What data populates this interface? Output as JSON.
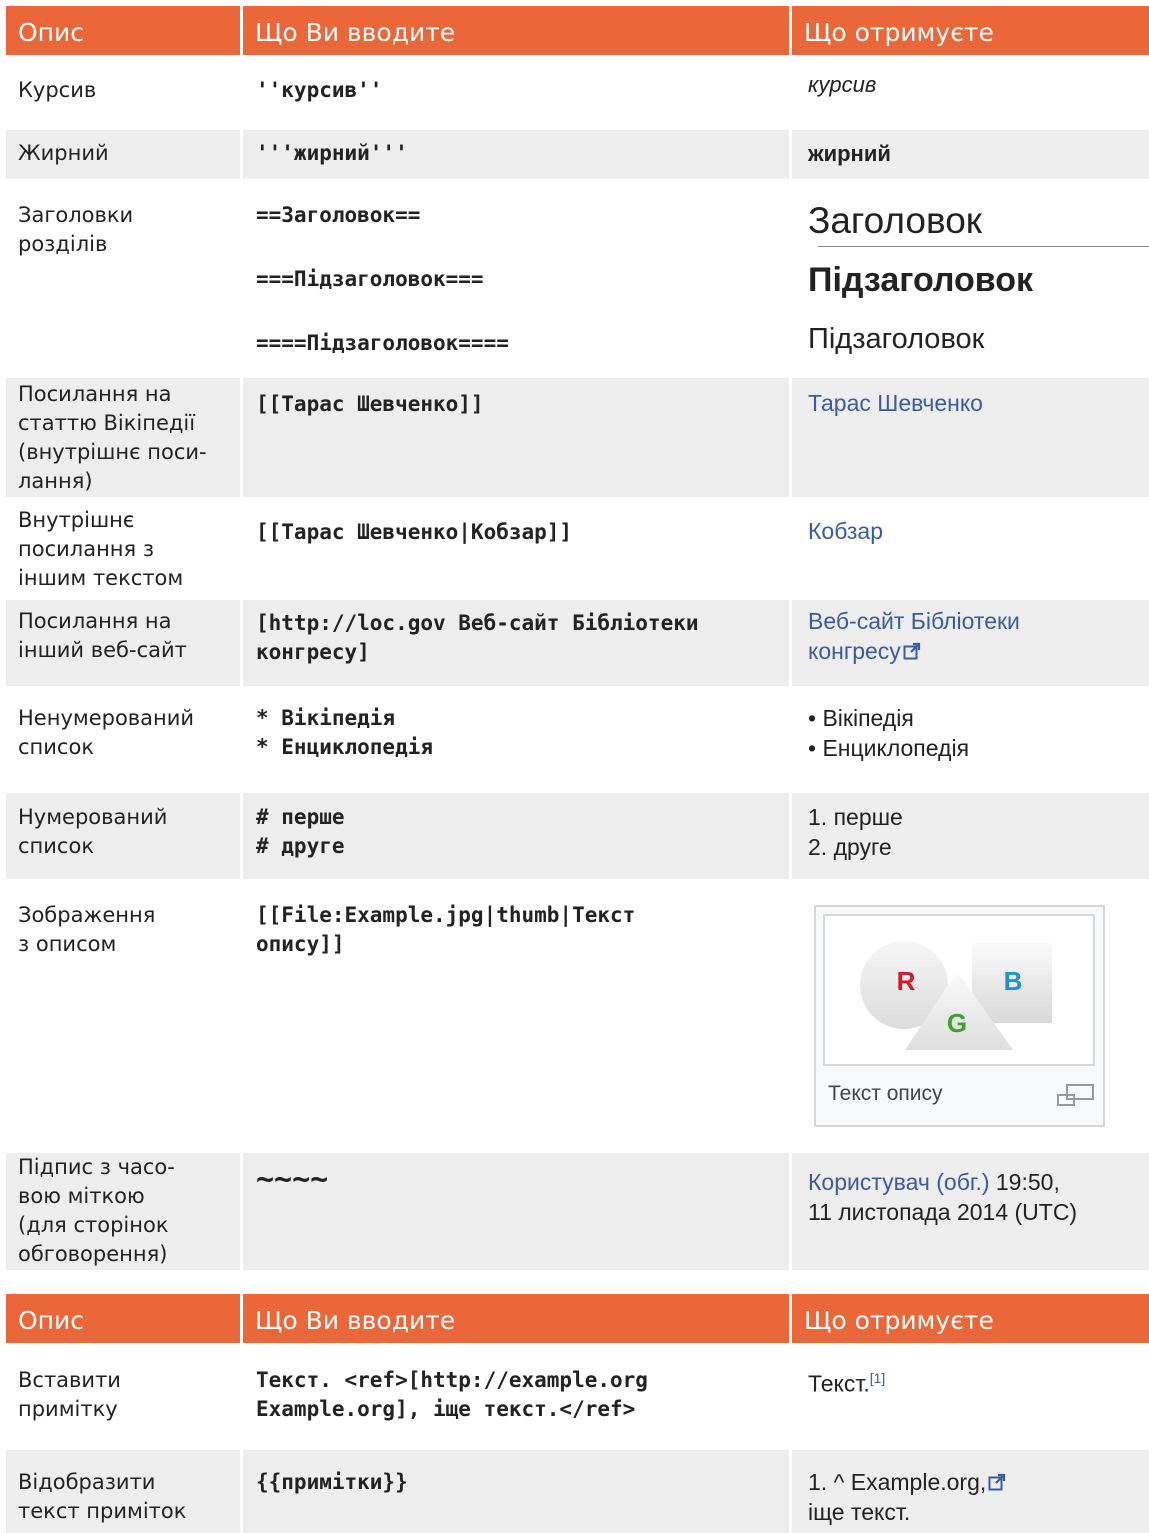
{
  "headers": {
    "col1": "Опис",
    "col2": "Що Ви вводите",
    "col3": "Що отримуєте"
  },
  "rows": {
    "italic": {
      "desc": "Курсив",
      "code": "''курсив''",
      "result": "курсив"
    },
    "bold": {
      "desc": "Жирний",
      "code": "'''жирний'''",
      "result": "жирний"
    },
    "headings": {
      "desc1": "Заголовки",
      "desc2": "розділів",
      "code1": "==Заголовок==",
      "code2": "===Підзаголовок===",
      "code3": "====Підзаголовок====",
      "result1": "Заголовок",
      "result2": "Підзаголовок",
      "result3": "Підзаголовок"
    },
    "internal_link": {
      "desc1": "Посилання на",
      "desc2": "статтю Вікіпедії",
      "desc3": "(внутрішнє поси-",
      "desc4": "лання)",
      "code": "[[Тарас Шевченко]]",
      "result": "Тарас Шевченко"
    },
    "piped_link": {
      "desc1": "Внутрішнє",
      "desc2": "посилання з",
      "desc3": "іншим текстом",
      "code": "[[Тарас Шевченко|Кобзар]]",
      "result": "Кобзар"
    },
    "external_link": {
      "desc1": "Посилання на",
      "desc2": "інший веб-сайт",
      "code1": "[http://loc.gov Веб-сайт Бібліотеки",
      "code2": "конгресу]",
      "result1": "Веб-сайт Бібліотеки",
      "result2": "конгресу"
    },
    "bullet_list": {
      "desc1": "Ненумерований",
      "desc2": "список",
      "code1": "* Вікіпедія",
      "code2": "* Енциклопедія",
      "result1": "• Вікіпедія",
      "result2": "• Енциклопедія"
    },
    "numbered_list": {
      "desc1": "Нумерований",
      "desc2": "список",
      "code1": "# перше",
      "code2": "# друге",
      "result1": "1. перше",
      "result2": "2. друге"
    },
    "image": {
      "desc1": "Зображення",
      "desc2": "з описом",
      "code1": "[[File:Example.jpg|thumb|Текст",
      "code2": "опису]]",
      "letter_r": "R",
      "letter_g": "G",
      "letter_b": "B",
      "caption": "Текст опису"
    },
    "signature": {
      "desc1": "Підпис з часо-",
      "desc2": "вою міткою",
      "desc3": "(для сторінок",
      "desc4": "обговорення)",
      "code": "~~~~",
      "result_link": "Користувач (обг.)",
      "result_time": " 19:50,",
      "result2": "11 листопада 2014 (UTC)"
    },
    "ref": {
      "desc1": "Вставити",
      "desc2": "примітку",
      "code1": "Текст. <ref>[http://example.org",
      "code2": "Example.org], іще текст.</ref>",
      "result": "Текст.",
      "sup": "[1]"
    },
    "references": {
      "desc1": "Відобразити",
      "desc2": "текст приміток",
      "code": "{{примітки}}",
      "result1": "1. ^ Example.org,",
      "result2": "іще текст."
    }
  },
  "colors": {
    "header_bg": "#eb6638",
    "alt_row_bg": "#eeeeee",
    "link": "#3b5aa6",
    "r": "#d7182a",
    "g": "#3aa52a",
    "b": "#1a93d6"
  }
}
